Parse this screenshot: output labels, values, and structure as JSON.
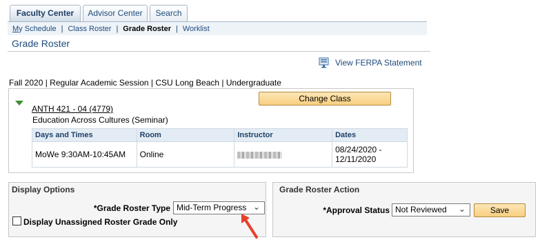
{
  "tabs": [
    {
      "label": "Faculty Center"
    },
    {
      "label": "Advisor Center"
    },
    {
      "label": "Search"
    }
  ],
  "subnav": [
    {
      "label": "My Schedule",
      "underline_first": "M",
      "rest": "y Schedule"
    },
    {
      "label": "Class Roster"
    },
    {
      "label": "Grade Roster"
    },
    {
      "label": "Worklist"
    }
  ],
  "page_title": "Grade Roster",
  "ferpa_link": "View FERPA Statement",
  "term_info": "Fall 2020 | Regular Academic Session | CSU Long Beach | Undergraduate",
  "change_class_label": "Change Class",
  "class": {
    "code": "ANTH 421 - 04 (4779)",
    "description": "Education Across Cultures (Seminar)"
  },
  "meeting_table": {
    "headers": [
      "Days and Times",
      "Room",
      "Instructor",
      "Dates"
    ],
    "row": {
      "days_times": "MoWe 9:30AM-10:45AM",
      "room": "Online",
      "instructor": "",
      "dates_line1": "08/24/2020 -",
      "dates_line2": "12/11/2020"
    }
  },
  "display_options": {
    "title": "Display Options",
    "roster_type_label": "*Grade Roster Type",
    "roster_type_value": "Mid-Term Progress",
    "unassigned_label": "Display Unassigned Roster Grade Only"
  },
  "grade_roster_action": {
    "title": "Grade Roster Action",
    "approval_label": "*Approval Status",
    "approval_value": "Not Reviewed",
    "save_label": "Save"
  },
  "colors": {
    "link": "#1e4a7a",
    "button_top": "#fde6b6",
    "button_bottom": "#f8cf80",
    "arrow": "#e8402b",
    "expand": "#3b8f2e"
  }
}
